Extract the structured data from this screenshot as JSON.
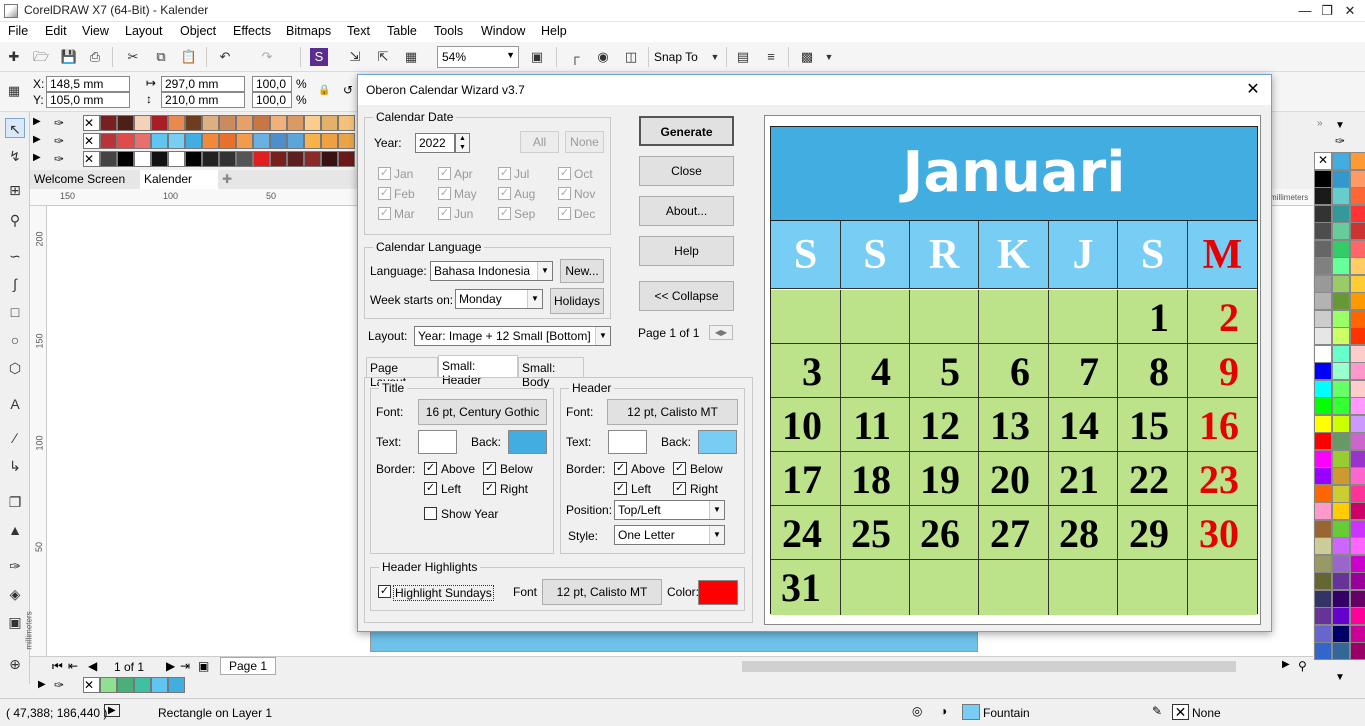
{
  "window": {
    "title": "CorelDRAW X7 (64-Bit) - Kalender"
  },
  "menu": [
    "File",
    "Edit",
    "View",
    "Layout",
    "Object",
    "Effects",
    "Bitmaps",
    "Text",
    "Table",
    "Tools",
    "Window",
    "Help"
  ],
  "toolbar": {
    "zoom": "54%",
    "snap_to": "Snap To"
  },
  "propbar": {
    "x_label": "X:",
    "x": "148,5 mm",
    "y_label": "Y:",
    "y": "105,0 mm",
    "w": "297,0 mm",
    "h": "210,0 mm",
    "sx": "100,0",
    "sy": "100,0",
    "pct": "%"
  },
  "doc_tabs": [
    "Welcome Screen",
    "Kalender"
  ],
  "ruler": {
    "h": [
      "150",
      "100",
      "50"
    ],
    "v": [
      "200",
      "150",
      "100",
      "50"
    ],
    "unit": "millimeters"
  },
  "page_nav": {
    "count": "1 of 1",
    "page": "Page 1"
  },
  "status": {
    "coords": "( 47,388; 186,440 )",
    "object": "Rectangle on Layer 1",
    "fill": "Fountain",
    "outline": "None"
  },
  "dialog": {
    "title": "Oberon Calendar Wizard v3.7",
    "calendar_date": {
      "group": "Calendar Date",
      "year_label": "Year:",
      "year": "2022",
      "all": "All",
      "none": "None",
      "months": [
        "Jan",
        "Apr",
        "Jul",
        "Oct",
        "Feb",
        "May",
        "Aug",
        "Nov",
        "Mar",
        "Jun",
        "Sep",
        "Dec"
      ]
    },
    "language": {
      "group": "Calendar Language",
      "language_label": "Language:",
      "language": "Bahasa Indonesia",
      "new_btn": "New...",
      "week_label": "Week starts on:",
      "week": "Monday",
      "holidays_btn": "Holidays"
    },
    "layout_label": "Layout:",
    "layout": "Year: Image + 12 Small [Bottom]",
    "buttons": {
      "generate": "Generate",
      "close": "Close",
      "about": "About...",
      "help": "Help",
      "collapse": "<< Collapse"
    },
    "page_of": "Page 1 of 1",
    "tabs": [
      "Page Layout",
      "Small: Header",
      "Small: Body"
    ],
    "title_group": {
      "group": "Title",
      "font_label": "Font:",
      "font": "16 pt, Century Gothic",
      "text_label": "Text:",
      "back_label": "Back:",
      "border_label": "Border:",
      "above": "Above",
      "below": "Below",
      "left": "Left",
      "right": "Right",
      "show_year": "Show Year",
      "text_color": "#ffffff",
      "back_color": "#42ade0"
    },
    "header_group": {
      "group": "Header",
      "font_label": "Font:",
      "font": "12 pt, Calisto MT",
      "text_label": "Text:",
      "back_label": "Back:",
      "border_label": "Border:",
      "above": "Above",
      "below": "Below",
      "left": "Left",
      "right": "Right",
      "position_label": "Position:",
      "position": "Top/Left",
      "style_label": "Style:",
      "style": "One Letter",
      "text_color": "#ffffff",
      "back_color": "#78cdf5"
    },
    "highlights": {
      "group": "Header Highlights",
      "highlight_sundays": "Highlight Sundays",
      "font_label": "Font",
      "font": "12 pt, Calisto MT",
      "color_label": "Color:",
      "color": "#ff0000"
    }
  },
  "preview": {
    "month": "Januari",
    "day_headers": [
      "S",
      "S",
      "R",
      "K",
      "J",
      "S",
      "M"
    ],
    "weeks": [
      [
        "",
        "",
        "",
        "",
        "",
        "1",
        "2"
      ],
      [
        "3",
        "4",
        "5",
        "6",
        "7",
        "8",
        "9"
      ],
      [
        "10",
        "11",
        "12",
        "13",
        "14",
        "15",
        "16"
      ],
      [
        "17",
        "18",
        "19",
        "20",
        "21",
        "22",
        "23"
      ],
      [
        "24",
        "25",
        "26",
        "27",
        "28",
        "29",
        "30"
      ],
      [
        "31",
        "",
        "",
        "",
        "",
        "",
        ""
      ]
    ],
    "colors": {
      "title_bg": "#42ade0",
      "header_bg": "#78cdf5",
      "cell_bg": "#bde38a",
      "sunday": "#e60000"
    }
  }
}
